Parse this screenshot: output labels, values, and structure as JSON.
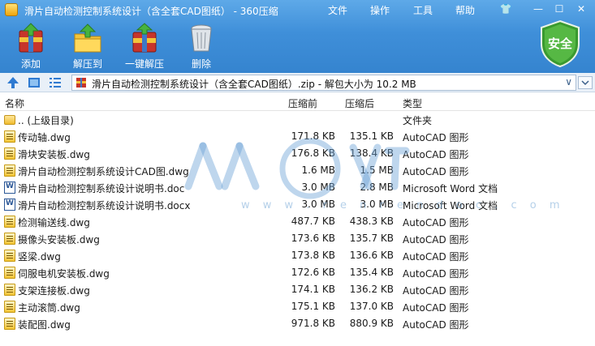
{
  "window": {
    "title": "滑片自动检测控制系统设计（含全套CAD图纸） - 360压缩",
    "menu": [
      "文件",
      "操作",
      "工具",
      "帮助"
    ],
    "controls": {
      "skin": "👕",
      "minimize": "—",
      "maximize": "☐",
      "close": "✕"
    }
  },
  "toolbar": {
    "add_label": "添加",
    "extract_label": "解压到",
    "one_click_label": "一键解压",
    "delete_label": "删除"
  },
  "security_badge": "安全",
  "address": {
    "path": "滑片自动检测控制系统设计（含全套CAD图纸）.zip - 解包大小为 10.2 MB"
  },
  "columns": {
    "name": "名称",
    "packed": "压缩前",
    "size": "压缩后",
    "type": "类型"
  },
  "rows": [
    {
      "name": ".. (上级目录)",
      "packed": "",
      "size": "",
      "type": "文件夹",
      "icon": "folder"
    },
    {
      "name": "传动轴.dwg",
      "packed": "171.8 KB",
      "size": "135.1 KB",
      "type": "AutoCAD 图形",
      "icon": "dwg"
    },
    {
      "name": "滑块安装板.dwg",
      "packed": "176.8 KB",
      "size": "138.4 KB",
      "type": "AutoCAD 图形",
      "icon": "dwg"
    },
    {
      "name": "滑片自动检测控制系统设计CAD图.dwg",
      "packed": "1.6 MB",
      "size": "1.5 MB",
      "type": "AutoCAD 图形",
      "icon": "dwg"
    },
    {
      "name": "滑片自动检测控制系统设计说明书.doc",
      "packed": "3.0 MB",
      "size": "2.8 MB",
      "type": "Microsoft Word 文档",
      "icon": "doc"
    },
    {
      "name": "滑片自动检测控制系统设计说明书.docx",
      "packed": "3.0 MB",
      "size": "3.0 MB",
      "type": "Microsoft Word 文档",
      "icon": "doc"
    },
    {
      "name": "检测输送线.dwg",
      "packed": "487.7 KB",
      "size": "438.3 KB",
      "type": "AutoCAD 图形",
      "icon": "dwg"
    },
    {
      "name": "摄像头安装板.dwg",
      "packed": "173.6 KB",
      "size": "135.7 KB",
      "type": "AutoCAD 图形",
      "icon": "dwg"
    },
    {
      "name": "竖梁.dwg",
      "packed": "173.8 KB",
      "size": "136.6 KB",
      "type": "AutoCAD 图形",
      "icon": "dwg"
    },
    {
      "name": "伺服电机安装板.dwg",
      "packed": "172.6 KB",
      "size": "135.4 KB",
      "type": "AutoCAD 图形",
      "icon": "dwg"
    },
    {
      "name": "支架连接板.dwg",
      "packed": "174.1 KB",
      "size": "136.2 KB",
      "type": "AutoCAD 图形",
      "icon": "dwg"
    },
    {
      "name": "主动滚筒.dwg",
      "packed": "175.1 KB",
      "size": "137.0 KB",
      "type": "AutoCAD 图形",
      "icon": "dwg"
    },
    {
      "name": "装配图.dwg",
      "packed": "971.8 KB",
      "size": "880.9 KB",
      "type": "AutoCAD 图形",
      "icon": "dwg"
    }
  ],
  "watermark": {
    "text": "w w w . r e n r e n d o c . c o m"
  }
}
